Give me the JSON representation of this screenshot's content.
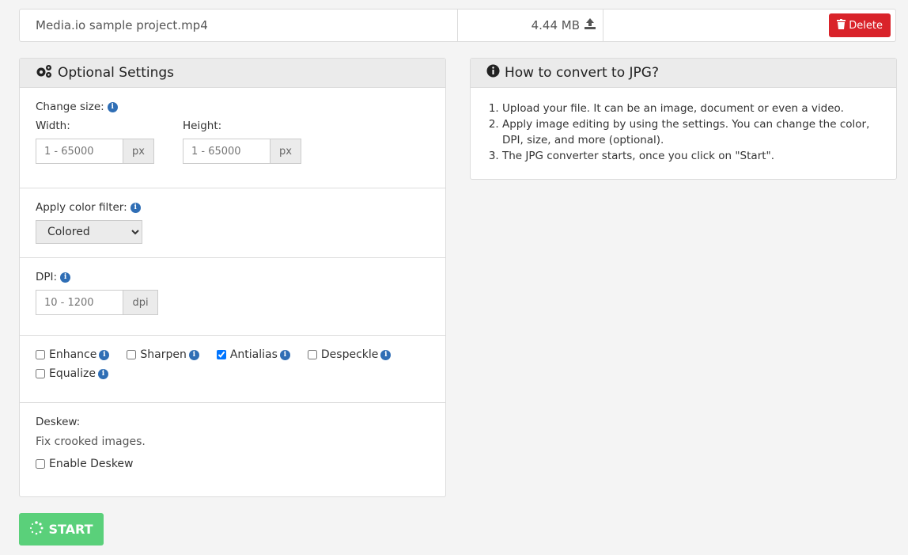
{
  "file": {
    "name": "Media.io sample project.mp4",
    "size": "4.44 MB",
    "delete_label": "Delete"
  },
  "settings": {
    "title": "Optional Settings",
    "change_size_label": "Change size:",
    "width_label": "Width:",
    "height_label": "Height:",
    "width_placeholder": "1 - 65000",
    "height_placeholder": "1 - 65000",
    "px_unit": "px",
    "color_filter_label": "Apply color filter:",
    "color_filter_value": "Colored",
    "dpi_label": "DPI:",
    "dpi_placeholder": "10 - 1200",
    "dpi_unit": "dpi",
    "checkboxes": {
      "enhance": "Enhance",
      "sharpen": "Sharpen",
      "antialias": "Antialias",
      "despeckle": "Despeckle",
      "equalize": "Equalize"
    },
    "checked": [
      "antialias"
    ],
    "deskew_label": "Deskew:",
    "deskew_desc": "Fix crooked images.",
    "enable_deskew_label": "Enable Deskew"
  },
  "howto": {
    "title": "How to convert to JPG?",
    "steps": [
      "Upload your file. It can be an image, document or even a video.",
      "Apply image editing by using the settings. You can change the color, DPI, size, and more (optional).",
      "The JPG converter starts, once you click on \"Start\"."
    ]
  },
  "start_label": "START",
  "colors": {
    "delete": "#d9232a",
    "start": "#5ad07a",
    "info": "#2f6eb5"
  }
}
